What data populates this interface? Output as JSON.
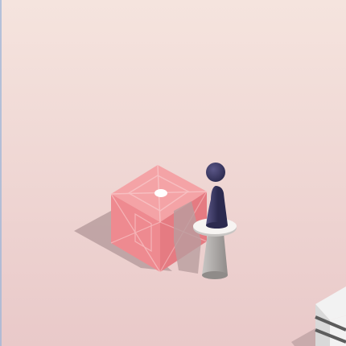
{
  "scene": {
    "view": "isometric",
    "colors": {
      "background_top": "#f5e4de",
      "background_bottom": "#e9c9c9",
      "left_edge_line": "#9fb6d8",
      "shadow": "#b99e9f",
      "cube_top": "#f4a3a6",
      "cube_left": "#ee8a90",
      "cube_right": "#e57b82",
      "cube_pattern": "#f8c3c5",
      "target_dot": "#ffffff",
      "player_body": "#2c2a4f",
      "player_highlight": "#5a5687",
      "pedestal_top": "#f7f4f2",
      "pedestal_stand_light": "#c9c6c4",
      "pedestal_stand_dark": "#8f8b89",
      "next_platform_top": "#f2f2f2",
      "next_platform_stripe": "#5c5c5c",
      "next_platform_side": "#d9d9d9"
    },
    "objects": [
      {
        "kind": "patterned-cube",
        "name": "pink-cube-platform"
      },
      {
        "kind": "target-dot",
        "name": "landing-target-dot"
      },
      {
        "kind": "pedestal",
        "name": "white-pedestal-platform"
      },
      {
        "kind": "player-piece",
        "name": "player-chess-piece"
      },
      {
        "kind": "striped-box",
        "name": "next-platform-box"
      }
    ]
  }
}
